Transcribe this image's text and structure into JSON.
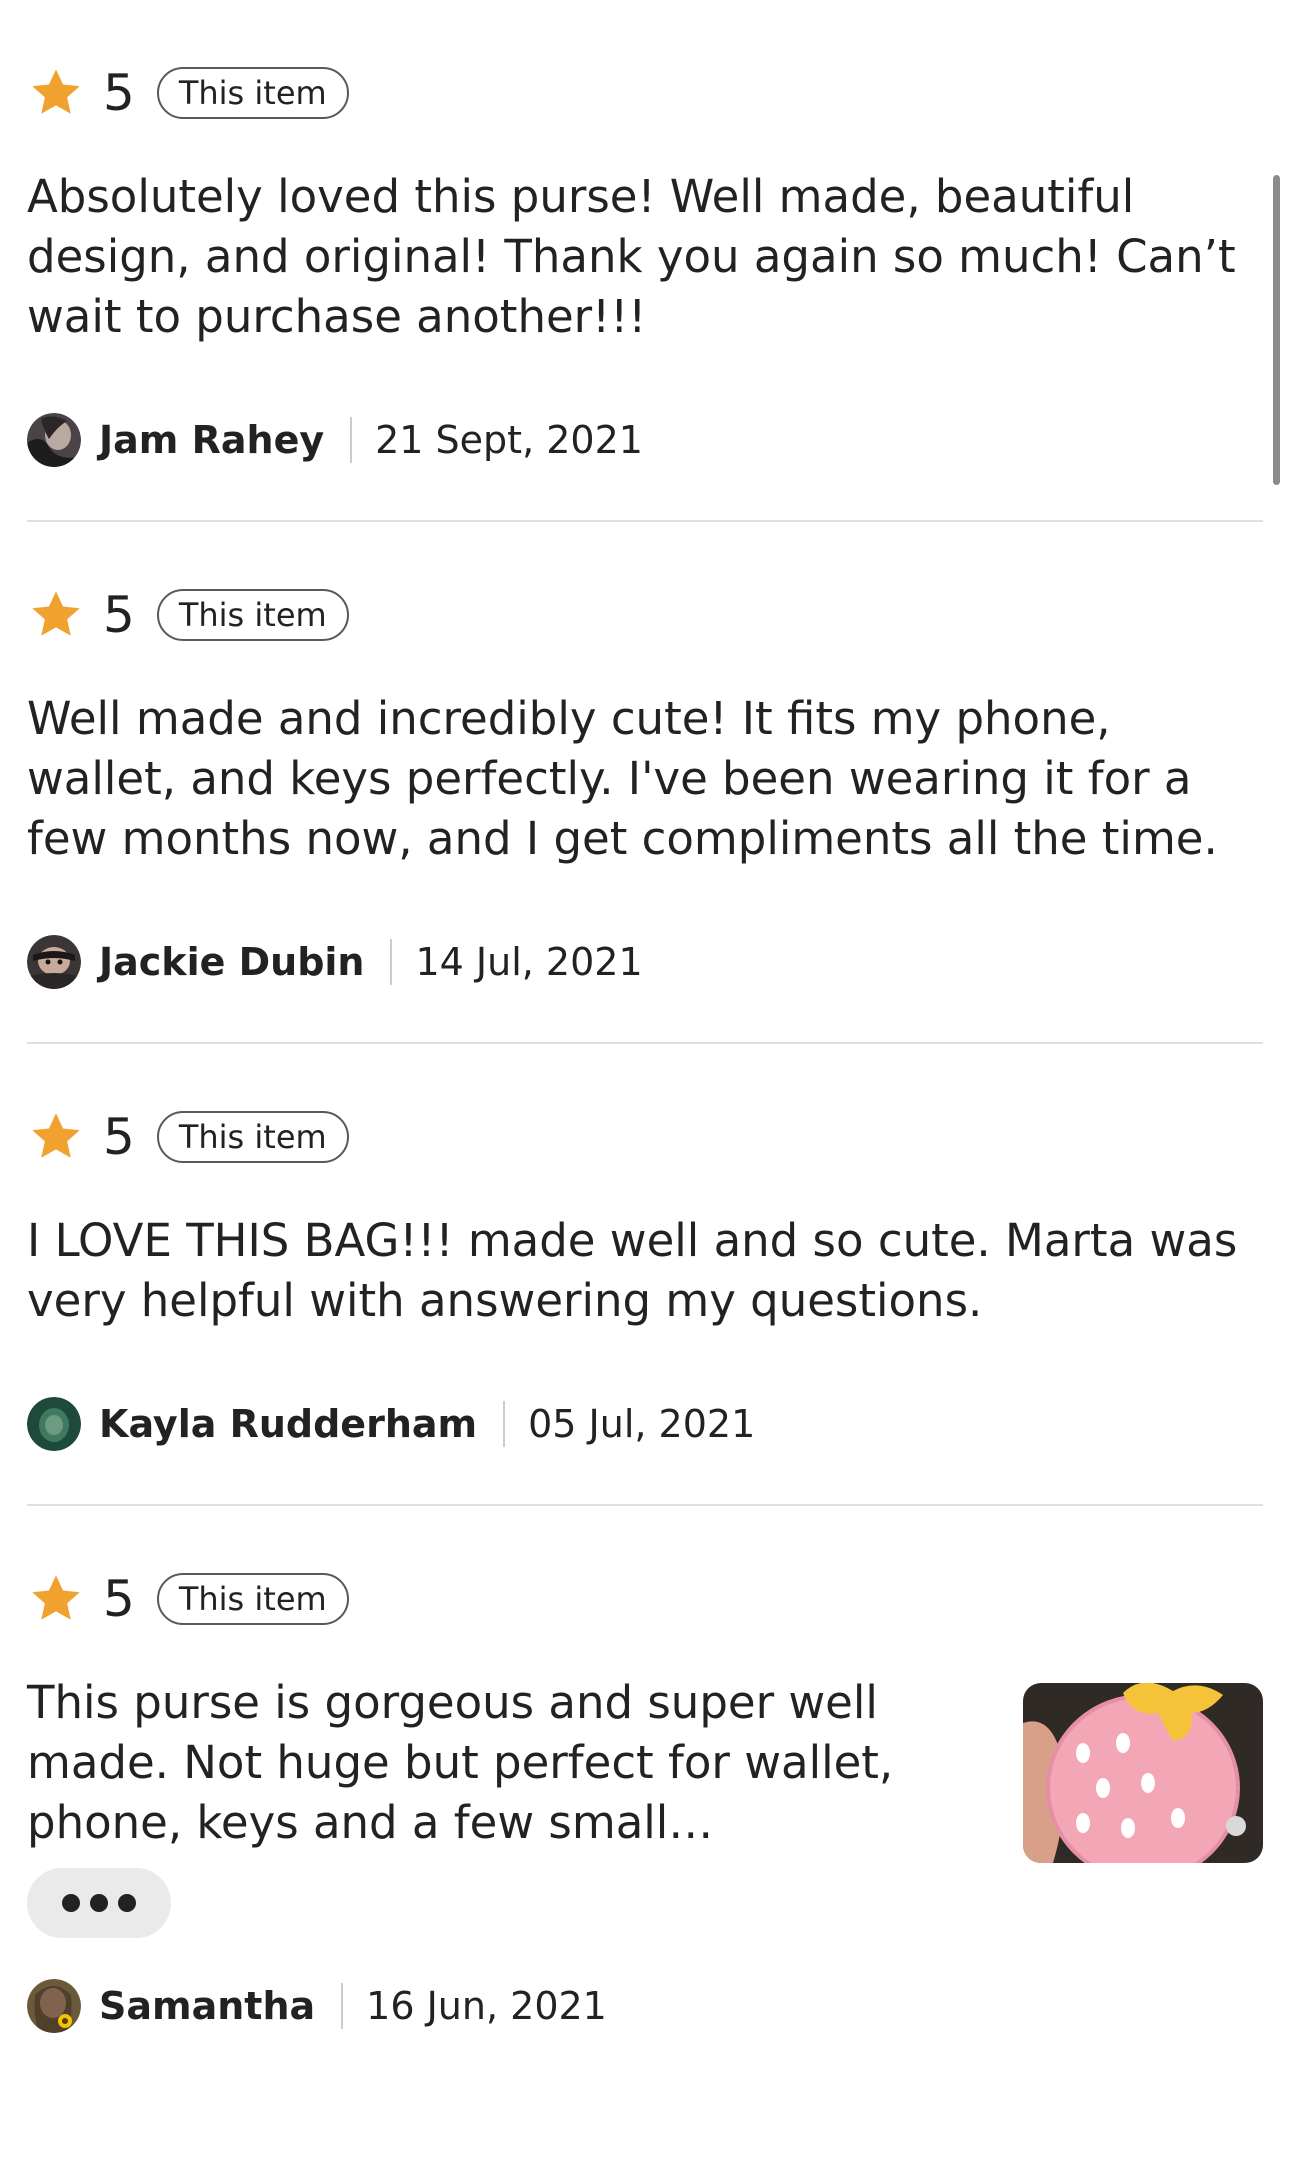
{
  "reviews": [
    {
      "rating": "5",
      "badge": "This item",
      "text": "Absolutely loved this purse! Well made, beautiful design, and original! Thank you again so much! Can’t wait to purchase another!!!",
      "author": "Jam Rahey",
      "date": "21 Sept, 2021"
    },
    {
      "rating": "5",
      "badge": "This item",
      "text": "Well made and incredibly cute! It fits my phone, wallet, and keys perfectly. I've been wearing it for a few months now, and I get compliments all the time.",
      "author": "Jackie Dubin",
      "date": "14 Jul, 2021"
    },
    {
      "rating": "5",
      "badge": "This item",
      "text": "I LOVE THIS BAG!!! made well and so cute. Marta was very helpful with answering my questions.",
      "author": "Kayla Rudderham",
      "date": "05 Jul, 2021"
    },
    {
      "rating": "5",
      "badge": "This item",
      "text": "This purse is gorgeous and super well made. Not huge but perfect for wallet, phone, keys and a few small…",
      "author": "Samantha",
      "date": "16 Jun, 2021",
      "photo_icon": "strawberry-purse-photo",
      "more_icon": "ellipsis-icon"
    }
  ],
  "colors": {
    "star": "#F1A12E",
    "divider": "#dedede",
    "more_button_bg": "#eaeaea",
    "scrollbar": "#8b8b8b"
  },
  "icons": {
    "star": "star-icon",
    "avatar": "avatar"
  }
}
